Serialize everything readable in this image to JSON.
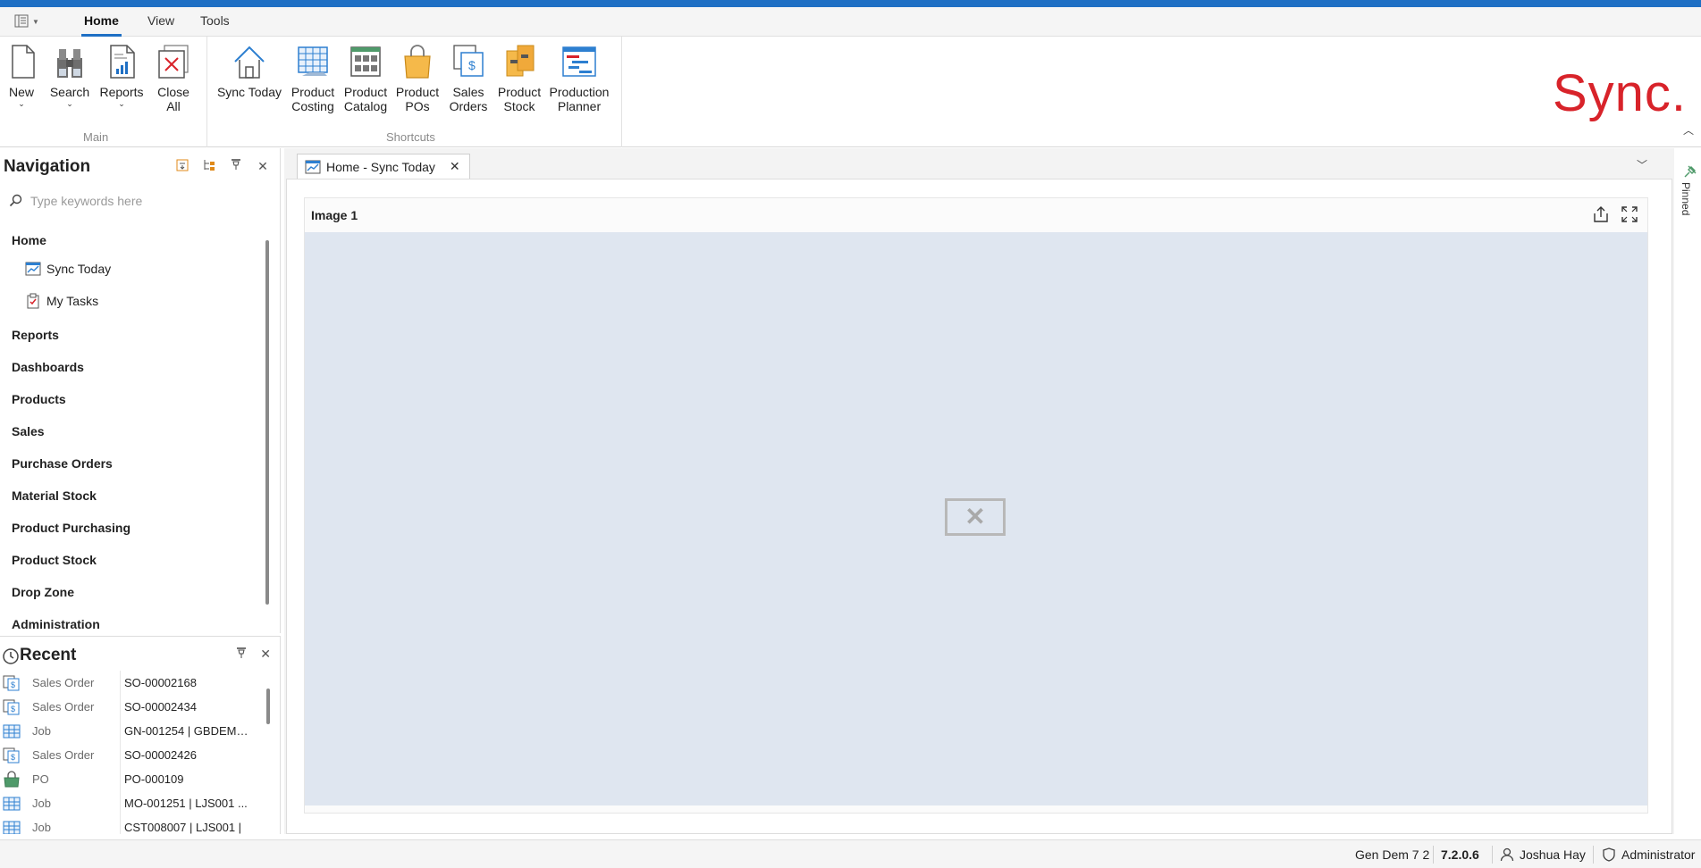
{
  "ribbon_tabs": [
    "Home",
    "View",
    "Tools"
  ],
  "ribbon": {
    "main_group": {
      "label": "Main",
      "buttons": [
        {
          "label": "New",
          "has_dropdown": true
        },
        {
          "label": "Search",
          "has_dropdown": true
        },
        {
          "label": "Reports",
          "has_dropdown": true
        },
        {
          "label": "Close\nAll",
          "has_dropdown": false
        }
      ]
    },
    "shortcuts_group": {
      "label": "Shortcuts",
      "buttons": [
        {
          "label": "Sync Today"
        },
        {
          "label": "Product\nCosting"
        },
        {
          "label": "Product\nCatalog"
        },
        {
          "label": "Product\nPOs"
        },
        {
          "label": "Sales\nOrders"
        },
        {
          "label": "Product\nStock"
        },
        {
          "label": "Production\nPlanner"
        }
      ]
    },
    "logo_text": "Sync."
  },
  "navigation": {
    "title": "Navigation",
    "search_placeholder": "Type keywords here",
    "groups": {
      "home": "Home",
      "reports": "Reports",
      "dashboards": "Dashboards",
      "products": "Products",
      "sales": "Sales",
      "purchase_orders": "Purchase Orders",
      "material_stock": "Material Stock",
      "product_purchasing": "Product Purchasing",
      "product_stock": "Product Stock",
      "drop_zone": "Drop Zone",
      "administration": "Administration"
    },
    "home_items": {
      "sync_today": "Sync Today",
      "my_tasks": "My Tasks"
    }
  },
  "recent": {
    "title": "Recent",
    "rows": [
      {
        "type": "Sales Order",
        "id": "SO-00002168",
        "icon": "sales-order-icon"
      },
      {
        "type": "Sales Order",
        "id": "SO-00002434",
        "icon": "sales-order-icon"
      },
      {
        "type": "Job",
        "id": "GN-001254 | GBDEMO...",
        "icon": "job-icon"
      },
      {
        "type": "Sales Order",
        "id": "SO-00002426",
        "icon": "sales-order-icon"
      },
      {
        "type": "PO",
        "id": "PO-000109",
        "icon": "po-icon"
      },
      {
        "type": "Job",
        "id": "MO-001251 | LJS001 ...",
        "icon": "job-icon"
      },
      {
        "type": "Job",
        "id": "CST008007 | LJS001 |",
        "icon": "job-icon"
      }
    ]
  },
  "document": {
    "tab_label": "Home - Sync Today",
    "card_title": "Image 1"
  },
  "pinned_label": "Pinned",
  "statusbar": {
    "database": "Gen Dem 7 2",
    "version": "7.2.0.6",
    "user": "Joshua Hay",
    "role": "Administrator"
  },
  "colors": {
    "accent": "#1e6fc4",
    "logo": "#d8232a",
    "image_placeholder_bg": "#dfe6f0"
  }
}
